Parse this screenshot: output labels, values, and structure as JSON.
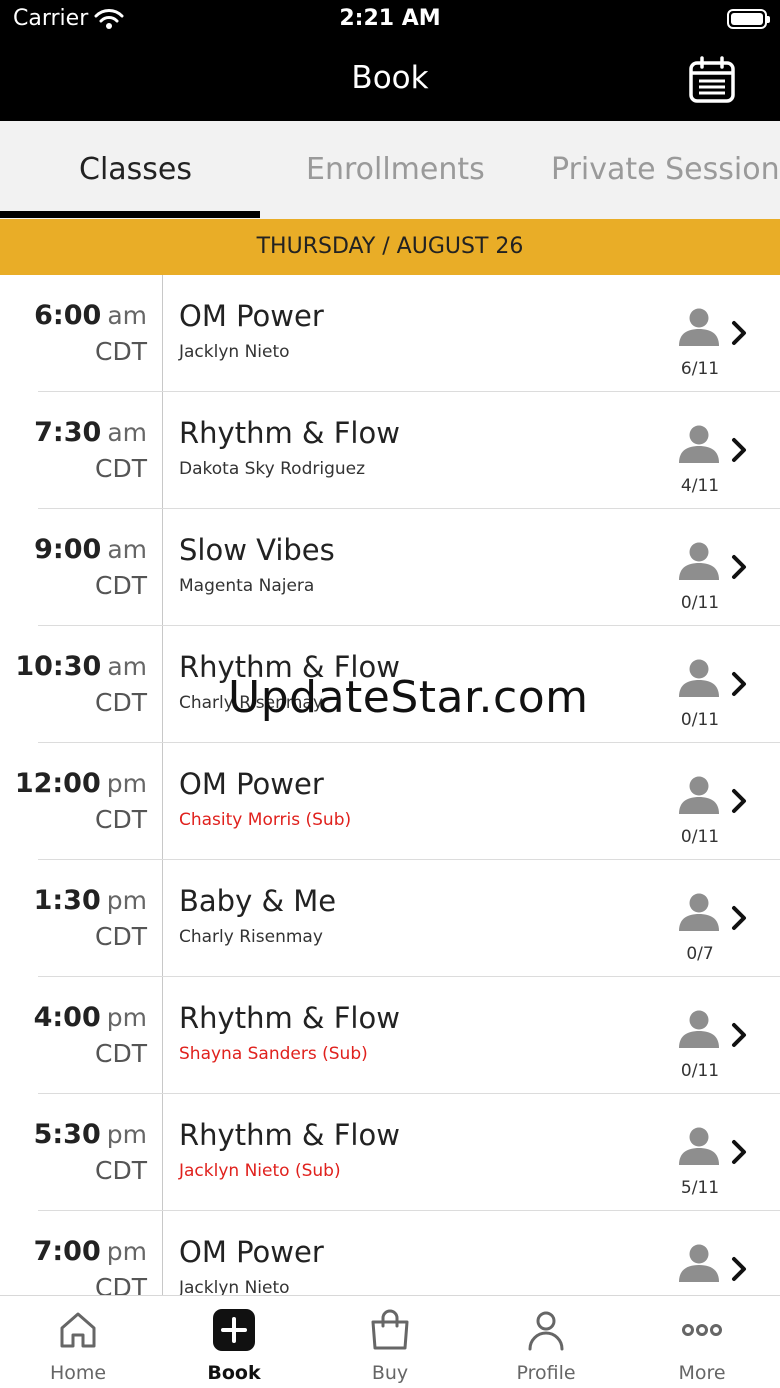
{
  "status_bar": {
    "carrier": "Carrier",
    "time": "2:21 AM",
    "icons": [
      "wifi-icon",
      "battery-icon"
    ]
  },
  "header": {
    "title": "Book",
    "right_icon": "calendar-icon"
  },
  "tabs": [
    {
      "label": "Classes",
      "active": true
    },
    {
      "label": "Enrollments",
      "active": false
    },
    {
      "label": "Private Sessions",
      "active": false
    }
  ],
  "date_header": "THURSDAY / AUGUST 26",
  "classes": [
    {
      "time": "6:00",
      "ampm": "am",
      "tz": "CDT",
      "name": "OM Power",
      "instructor": "Jacklyn Nieto",
      "sub": false,
      "capacity": "6/11"
    },
    {
      "time": "7:30",
      "ampm": "am",
      "tz": "CDT",
      "name": "Rhythm & Flow",
      "instructor": "Dakota Sky Rodriguez",
      "sub": false,
      "capacity": "4/11"
    },
    {
      "time": "9:00",
      "ampm": "am",
      "tz": "CDT",
      "name": "Slow Vibes",
      "instructor": "Magenta Najera",
      "sub": false,
      "capacity": "0/11"
    },
    {
      "time": "10:30",
      "ampm": "am",
      "tz": "CDT",
      "name": "Rhythm & Flow",
      "instructor": "Charly Risenmay",
      "sub": false,
      "capacity": "0/11"
    },
    {
      "time": "12:00",
      "ampm": "pm",
      "tz": "CDT",
      "name": "OM Power",
      "instructor": "Chasity Morris (Sub)",
      "sub": true,
      "capacity": "0/11"
    },
    {
      "time": "1:30",
      "ampm": "pm",
      "tz": "CDT",
      "name": "Baby & Me",
      "instructor": "Charly Risenmay",
      "sub": false,
      "capacity": "0/7"
    },
    {
      "time": "4:00",
      "ampm": "pm",
      "tz": "CDT",
      "name": "Rhythm & Flow",
      "instructor": "Shayna Sanders (Sub)",
      "sub": true,
      "capacity": "0/11"
    },
    {
      "time": "5:30",
      "ampm": "pm",
      "tz": "CDT",
      "name": "Rhythm & Flow",
      "instructor": "Jacklyn Nieto (Sub)",
      "sub": true,
      "capacity": "5/11"
    },
    {
      "time": "7:00",
      "ampm": "pm",
      "tz": "CDT",
      "name": "OM Power",
      "instructor": "Jacklyn Nieto",
      "sub": false,
      "capacity": ""
    }
  ],
  "watermark": "UpdateStar.com",
  "bottom_tabs": [
    {
      "label": "Home",
      "icon": "home-icon",
      "active": false
    },
    {
      "label": "Book",
      "icon": "plus-square-icon",
      "active": true
    },
    {
      "label": "Buy",
      "icon": "shopping-bag-icon",
      "active": false
    },
    {
      "label": "Profile",
      "icon": "profile-icon",
      "active": false
    },
    {
      "label": "More",
      "icon": "more-dots-icon",
      "active": false
    }
  ],
  "colors": {
    "accent_band": "#e9ad27",
    "sub_instructor": "#e0211d",
    "header_bg": "#000000"
  }
}
